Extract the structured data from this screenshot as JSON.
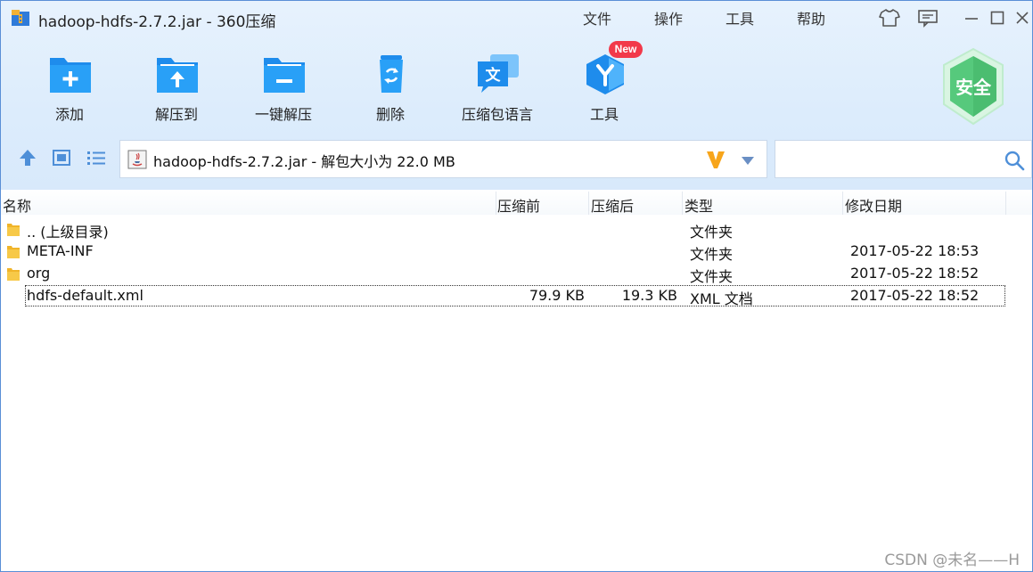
{
  "window": {
    "title": "hadoop-hdfs-2.7.2.jar - 360压缩"
  },
  "menu": [
    "文件",
    "操作",
    "工具",
    "帮助"
  ],
  "toolbar": {
    "add": "添加",
    "extract_to": "解压到",
    "one_click_extract": "一键解压",
    "delete": "删除",
    "archive_language": "压缩包语言",
    "tools": "工具",
    "new_badge": "New",
    "security_badge": "安全"
  },
  "address": {
    "path": "hadoop-hdfs-2.7.2.jar - 解包大小为 22.0 MB"
  },
  "search": {
    "value": "",
    "placeholder": ""
  },
  "columns": {
    "name": "名称",
    "before": "压缩前",
    "after": "压缩后",
    "type": "类型",
    "modified": "修改日期"
  },
  "files": [
    {
      "name": ".. (上级目录)",
      "before": "",
      "after": "",
      "type": "文件夹",
      "modified": "",
      "icon": "folder-icon"
    },
    {
      "name": "META-INF",
      "before": "",
      "after": "",
      "type": "文件夹",
      "modified": "2017-05-22 18:53",
      "icon": "folder-icon"
    },
    {
      "name": "org",
      "before": "",
      "after": "",
      "type": "文件夹",
      "modified": "2017-05-22 18:52",
      "icon": "folder-icon"
    },
    {
      "name": "hdfs-default.xml",
      "before": "79.9 KB",
      "after": "19.3 KB",
      "type": "XML 文档",
      "modified": "2017-05-22 18:52",
      "icon": "",
      "selected": true
    }
  ],
  "watermark": "CSDN @未名——H",
  "colors": {
    "accent": "#1e90f0",
    "title_band": "#dcecfc",
    "badge_red": "#f2394a",
    "shield_green": "#4cc471"
  }
}
